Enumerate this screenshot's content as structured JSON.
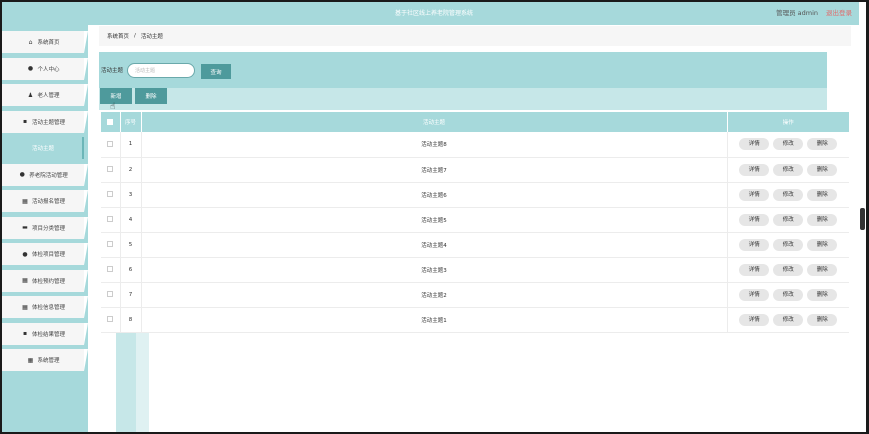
{
  "header": {
    "title": "基于社区线上养老院管理系统",
    "user_label": "管理员 admin",
    "logout_label": "退出登录"
  },
  "sidebar": {
    "items": [
      {
        "icon": "home-icon",
        "glyph": "⌂",
        "label": "系统首页"
      },
      {
        "icon": "user-icon",
        "glyph": "●",
        "label": "个人中心"
      },
      {
        "icon": "elder-icon",
        "glyph": "♟",
        "label": "老人管理"
      },
      {
        "icon": "topic-icon",
        "glyph": "▪",
        "label": "活动主题管理"
      },
      {
        "icon": "",
        "glyph": "",
        "label": "活动主题",
        "active": true
      },
      {
        "icon": "pin-icon",
        "glyph": "●",
        "label": "养老院活动管理"
      },
      {
        "icon": "grid-icon",
        "glyph": "▦",
        "label": "活动报名管理"
      },
      {
        "icon": "briefcase-icon",
        "glyph": "▬",
        "label": "项目分类管理"
      },
      {
        "icon": "user-icon",
        "glyph": "●",
        "label": "体检项目管理"
      },
      {
        "icon": "grid-icon",
        "glyph": "▦",
        "label": "体检预约管理"
      },
      {
        "icon": "grid-icon",
        "glyph": "▦",
        "label": "体检信息管理"
      },
      {
        "icon": "clipboard-icon",
        "glyph": "▪",
        "label": "体检结果管理"
      },
      {
        "icon": "apps-icon",
        "glyph": "▦",
        "label": "系统管理"
      }
    ]
  },
  "breadcrumb": {
    "home": "系统首页",
    "separator": "/",
    "current": "活动主题"
  },
  "search": {
    "label": "活动主题",
    "placeholder": "活动主题",
    "button": "查询"
  },
  "actions": {
    "add": "新增",
    "delete": "删除"
  },
  "table": {
    "columns": [
      "",
      "序号",
      "活动主题",
      "操作"
    ],
    "row_actions": [
      "详情",
      "修改",
      "删除"
    ],
    "rows": [
      {
        "index": "1",
        "topic": "活动主题8"
      },
      {
        "index": "2",
        "topic": "活动主题7"
      },
      {
        "index": "3",
        "topic": "活动主题6"
      },
      {
        "index": "4",
        "topic": "活动主题5"
      },
      {
        "index": "5",
        "topic": "活动主题4"
      },
      {
        "index": "6",
        "topic": "活动主题3"
      },
      {
        "index": "7",
        "topic": "活动主题2"
      },
      {
        "index": "8",
        "topic": "活动主题1"
      }
    ]
  },
  "colors": {
    "accent": "#a6d9db",
    "button": "#4e9a9c",
    "logout": "#e06b6b"
  }
}
